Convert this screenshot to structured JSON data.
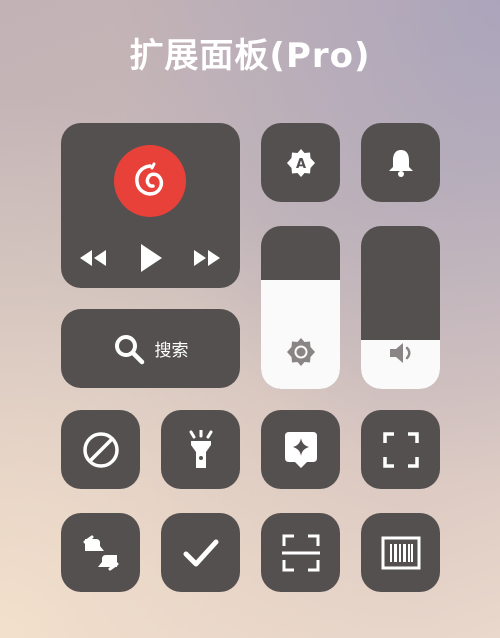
{
  "title": "扩展面板(Pro)",
  "media": {
    "app_icon": "netease-music-icon",
    "controls": [
      "previous-icon",
      "play-icon",
      "next-icon"
    ],
    "accent": "#e8413a"
  },
  "search": {
    "label": "搜索",
    "icon": "search-icon"
  },
  "brightness": {
    "level": 0.67,
    "icon": "brightness-icon"
  },
  "volume": {
    "level": 0.3,
    "icon": "volume-icon"
  },
  "tiles": {
    "auto_brightness": "auto-brightness-icon",
    "notification": "bell-icon",
    "do_not_disturb": "block-icon",
    "flashlight": "flashlight-icon",
    "assistant": "sparkle-icon",
    "screenshot": "screenshot-icon",
    "translate": "translate-icon",
    "confirm": "check-icon",
    "scan": "scan-icon",
    "barcode": "barcode-icon"
  },
  "colors": {
    "tile": "#555050",
    "slider_fill": "#fafafa",
    "icon": "#ffffff"
  }
}
